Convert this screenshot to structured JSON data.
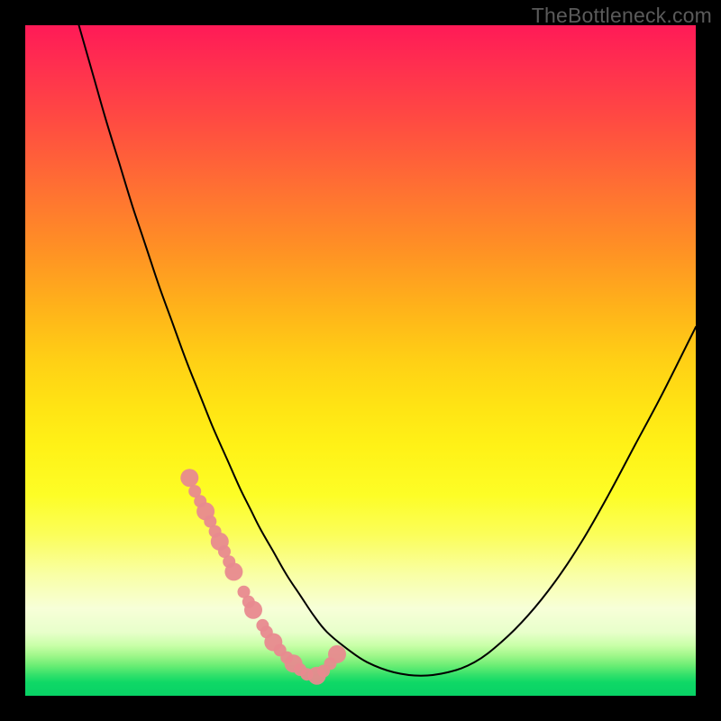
{
  "watermark": "TheBottleneck.com",
  "chart_data": {
    "type": "line",
    "title": "",
    "xlabel": "",
    "ylabel": "",
    "xlim": [
      0,
      100
    ],
    "ylim": [
      0,
      100
    ],
    "series": [
      {
        "name": "bottleneck-curve",
        "x": [
          8,
          10,
          12,
          14,
          16,
          18,
          20,
          22,
          24,
          26,
          28,
          30,
          32,
          33.5,
          35,
          37,
          39,
          41,
          43,
          45,
          48,
          51,
          55,
          59,
          63,
          67,
          71,
          75,
          79,
          83,
          87,
          91,
          95,
          99,
          100
        ],
        "values": [
          100,
          93,
          86,
          79.5,
          73,
          67,
          61,
          55.5,
          50,
          45,
          40,
          35.5,
          31,
          28,
          25,
          21.5,
          18,
          15,
          12,
          9.5,
          7,
          5,
          3.5,
          3,
          3.5,
          5,
          8,
          12,
          17,
          23,
          30,
          37.5,
          45,
          53,
          55
        ]
      }
    ],
    "markers": {
      "name": "highlighted-points",
      "color": "#e88a8f",
      "x": [
        24.5,
        25.3,
        26.1,
        26.9,
        27.6,
        28.3,
        29.0,
        29.7,
        30.4,
        31.1,
        32.6,
        33.3,
        34.0,
        35.4,
        36.0,
        37.0,
        38.0,
        39.0,
        40.0,
        41.0,
        42.0,
        43.5,
        44.5,
        45.5,
        46.5
      ],
      "values": [
        32.5,
        30.5,
        29.0,
        27.5,
        26.0,
        24.5,
        23.0,
        21.5,
        20.0,
        18.5,
        15.5,
        14.0,
        12.8,
        10.5,
        9.5,
        8.0,
        6.8,
        5.7,
        4.8,
        3.9,
        3.2,
        3.0,
        3.7,
        4.8,
        6.2
      ]
    },
    "gradient_stops": [
      {
        "pos": 0,
        "color": "#ff1a57"
      },
      {
        "pos": 0.5,
        "color": "#ffd015"
      },
      {
        "pos": 0.82,
        "color": "#f9ffa6"
      },
      {
        "pos": 1.0,
        "color": "#08d265"
      }
    ]
  }
}
